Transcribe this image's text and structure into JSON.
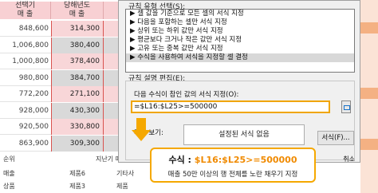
{
  "sheet": {
    "header_top": "선택기",
    "header_left": "매 출",
    "header_right": "매 출",
    "header_top_right": "당해년도",
    "rows": [
      {
        "a": "848,600",
        "b": "314,300"
      },
      {
        "a": "1,006,800",
        "b": "380,400"
      },
      {
        "a": "1,000,800",
        "b": "378,400"
      },
      {
        "a": "980,800",
        "b": "384,700"
      },
      {
        "a": "772,200",
        "b": "271,100"
      },
      {
        "a": "928,000",
        "b": "430,300"
      },
      {
        "a": "920,500",
        "b": "330,800"
      },
      {
        "a": "863,900",
        "b": "309,300"
      }
    ],
    "lower_left_1": "순위",
    "lower_left_2": "매출",
    "lower_left_3": "상품",
    "lower_mid_1": "지난기 매출",
    "lower_mid_2": "제품6",
    "lower_mid_3": "제품3",
    "lower_right": "기타사",
    "lower_right_2": "제품"
  },
  "dialog": {
    "rule_type_label": "규칙 유형 선택(S):",
    "rule_types": [
      "▶ 셀 값을 기준으로 모든 셀의 서식 지정",
      "▶ 다음을 포함하는 셀만 서식 지정",
      "▶ 상위 또는 하위 값만 서식 지정",
      "▶ 평균보다 크거나 작은 값만 서식 지정",
      "▶ 고유 또는 중복 값만 서식 지정",
      "▶ 수식을 사용하여 서식을 지정할 셀 결정"
    ],
    "selected_index": 5,
    "rule_edit_label": "규칙 설명 편집(E):",
    "formula_label": "다음 수식이 참인 값의 서식 지정(O):",
    "formula_value": "=$L16:$L25>=500000",
    "preview_label": "미리 보기:",
    "preview_text": "설정된 서식 없음",
    "format_button": "서식(F)...",
    "cancel_button": "취소"
  },
  "callout": {
    "title_prefix": "수식 : ",
    "title_value": "$L16:$L25>=500000",
    "description": "매출 50만 이상의 행 전체를 노란 채우기 지정"
  },
  "colors": {
    "accent": "#f5a800",
    "formula_highlight": "#f08a00",
    "sheet_pink": "#f8d6d8"
  }
}
